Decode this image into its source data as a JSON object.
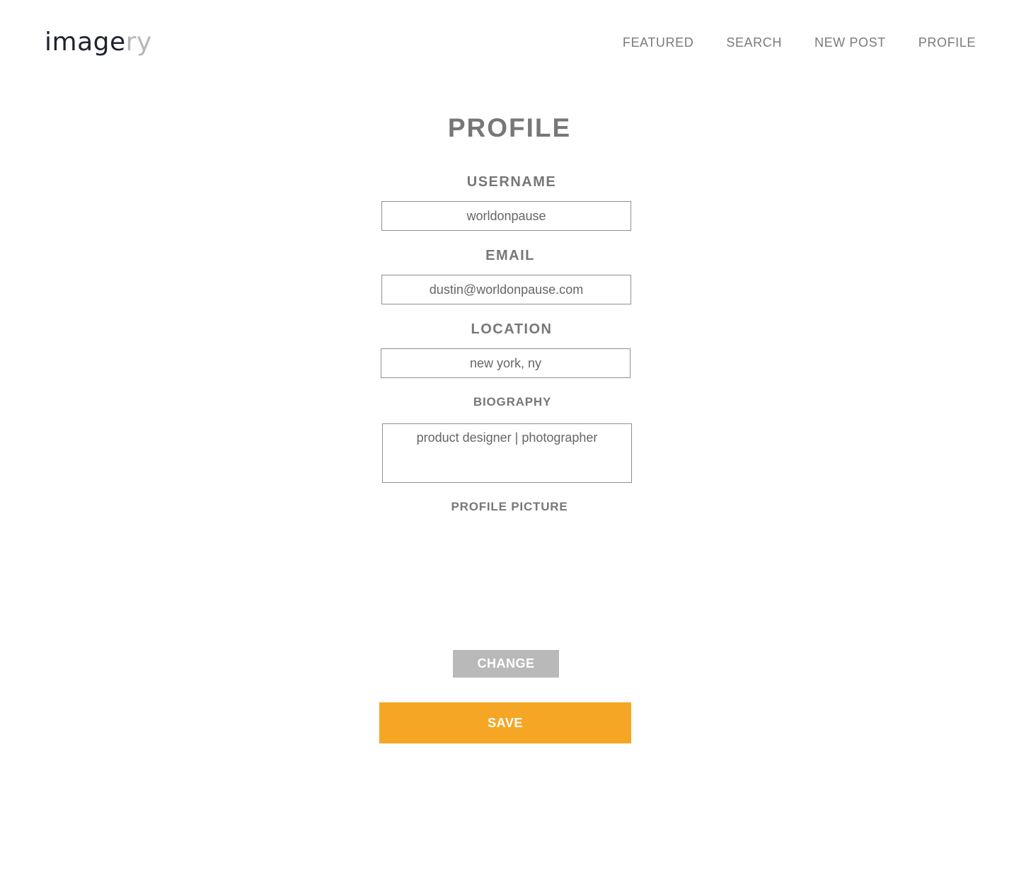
{
  "logo": {
    "part1": "image",
    "part2": "ry"
  },
  "nav": {
    "items": [
      {
        "label": "FEATURED"
      },
      {
        "label": "SEARCH"
      },
      {
        "label": "NEW POST"
      },
      {
        "label": "PROFILE"
      }
    ]
  },
  "page": {
    "title": "PROFILE"
  },
  "form": {
    "username": {
      "label": "USERNAME",
      "value": "worldonpause"
    },
    "email": {
      "label": "EMAIL",
      "value": "dustin@worldonpause.com"
    },
    "location": {
      "label": "LOCATION",
      "value": "new york, ny"
    },
    "biography": {
      "label": "BIOGRAPHY",
      "value": "product designer | photographer"
    },
    "profile_picture": {
      "label": "PROFILE PICTURE"
    },
    "change_label": "CHANGE",
    "save_label": "SAVE"
  },
  "colors": {
    "accent": "#f4a624",
    "secondary_button": "#b9b9b9",
    "text": "#777777",
    "logo_dark": "#1f2230",
    "logo_light": "#b8b8b8"
  }
}
